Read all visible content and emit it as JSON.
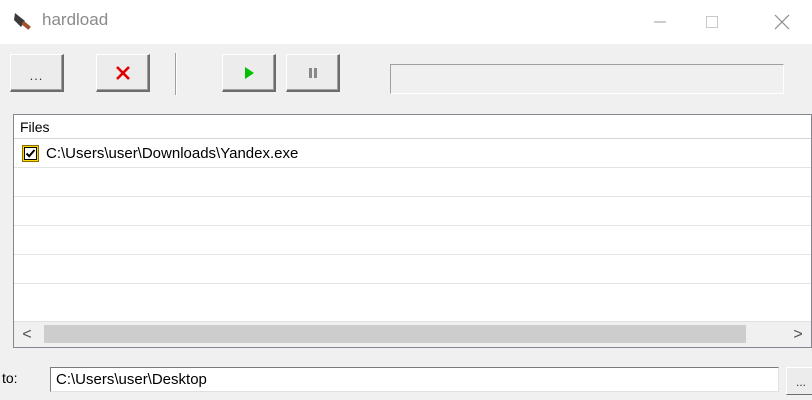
{
  "window": {
    "title": "hardload",
    "icon": "trowel-icon",
    "controls": {
      "minimize": "—",
      "maximize": "☐",
      "close": "✕"
    }
  },
  "toolbar": {
    "browse_label": "...",
    "buttons": [
      {
        "name": "browse",
        "icon": "ellipsis-icon"
      },
      {
        "name": "remove",
        "icon": "red-x-icon",
        "color": "#e00000"
      },
      {
        "name": "start",
        "icon": "play-icon",
        "color": "#00c000"
      },
      {
        "name": "pause",
        "icon": "pause-icon",
        "color": "#888888"
      }
    ],
    "progress": 0
  },
  "file_list": {
    "column_header": "Files",
    "rows": [
      {
        "checked": true,
        "path": "C:\\Users\\user\\Downloads\\Yandex.exe"
      }
    ],
    "empty_rows": 4,
    "scroll": {
      "left_arrow": "<",
      "right_arrow": ">"
    }
  },
  "destination": {
    "label": "to:",
    "path": "C:\\Users\\user\\Desktop",
    "browse_label": "..."
  },
  "colors": {
    "checkbox_highlight": "#ffd800",
    "play": "#00c000",
    "remove": "#e00000"
  }
}
